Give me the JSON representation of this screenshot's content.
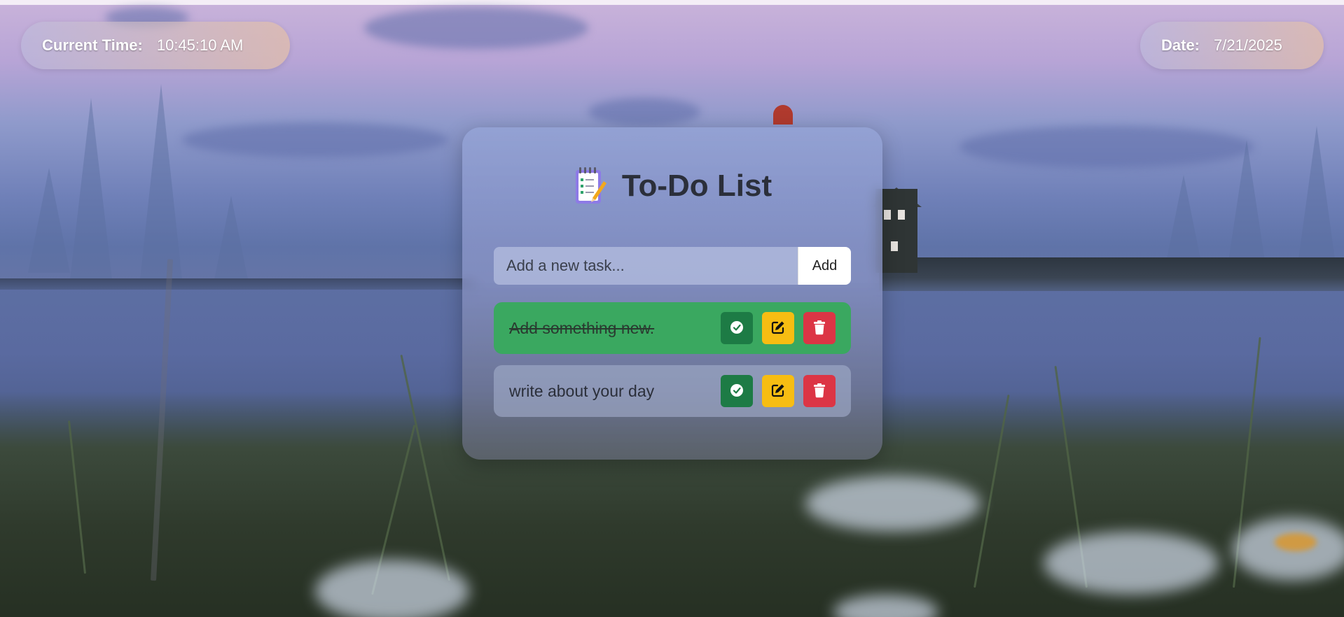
{
  "header": {
    "time_label": "Current Time:",
    "time_value": "10:45:10 AM",
    "date_label": "Date:",
    "date_value": "7/21/2025"
  },
  "card": {
    "title": "To-Do List",
    "title_icon": "notepad-icon",
    "input_placeholder": "Add a new task...",
    "add_label": "Add"
  },
  "tasks": [
    {
      "text": "Add something new.",
      "completed": true
    },
    {
      "text": "write about your day",
      "completed": false
    }
  ],
  "icons": {
    "complete": "check-circle-icon",
    "edit": "pencil-square-icon",
    "delete": "trash-icon"
  },
  "colors": {
    "completed_task_bg": "#3aa860",
    "done_button": "#1d7b45",
    "edit_button": "#f7bd12",
    "delete_button": "#dc3545"
  }
}
